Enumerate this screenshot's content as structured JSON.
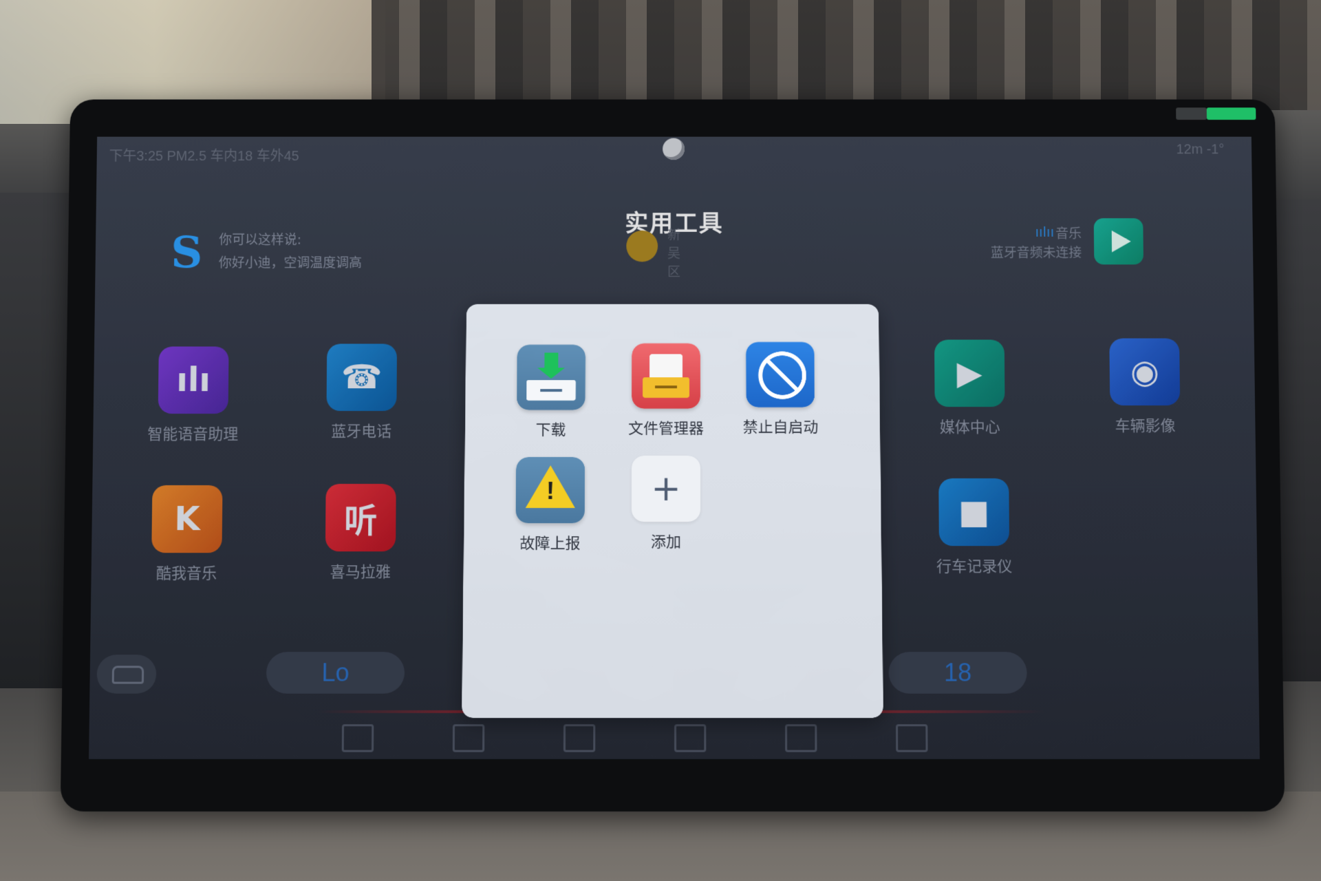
{
  "status_bar": {
    "left_text": "下午3:25 PM2.5 车内18 车外45",
    "right_text": "12m -1°"
  },
  "page_title": "实用工具",
  "voice_hint": {
    "line1": "你可以这样说:",
    "line2": "你好小迪，空调温度调高"
  },
  "weather_hint": "新吴区",
  "music_widget": {
    "label": "音乐",
    "status": "蓝牙音频未连接"
  },
  "background_apps": [
    {
      "label": "智能语音助理",
      "icon": "voice-assistant-icon"
    },
    {
      "label": "蓝牙电话",
      "icon": "bluetooth-phone-icon"
    },
    {
      "label": "酷我音乐",
      "icon": "kuwo-music-icon"
    },
    {
      "label": "喜马拉雅",
      "icon": "ximalaya-icon"
    },
    {
      "label": "媒体中心",
      "icon": "media-center-icon"
    },
    {
      "label": "车辆影像",
      "icon": "vehicle-camera-icon"
    },
    {
      "label": "行车记录仪",
      "icon": "dashcam-icon"
    }
  ],
  "dock": {
    "temp_left": "Lo",
    "temp_right": "18"
  },
  "modal": {
    "title": "实用工具",
    "tools": [
      {
        "label": "下载",
        "icon": "download-icon"
      },
      {
        "label": "文件管理器",
        "icon": "file-manager-icon"
      },
      {
        "label": "禁止自启动",
        "icon": "autostart-block-icon"
      },
      {
        "label": "故障上报",
        "icon": "warning-icon"
      },
      {
        "label": "添加",
        "icon": "plus-icon"
      }
    ]
  },
  "colors": {
    "modal_bg": "#dde2ea",
    "screen_bg": "#323845",
    "accent_blue": "#2e84e5",
    "accent_green": "#1ec15b",
    "warning_yellow": "#f4cd24"
  }
}
